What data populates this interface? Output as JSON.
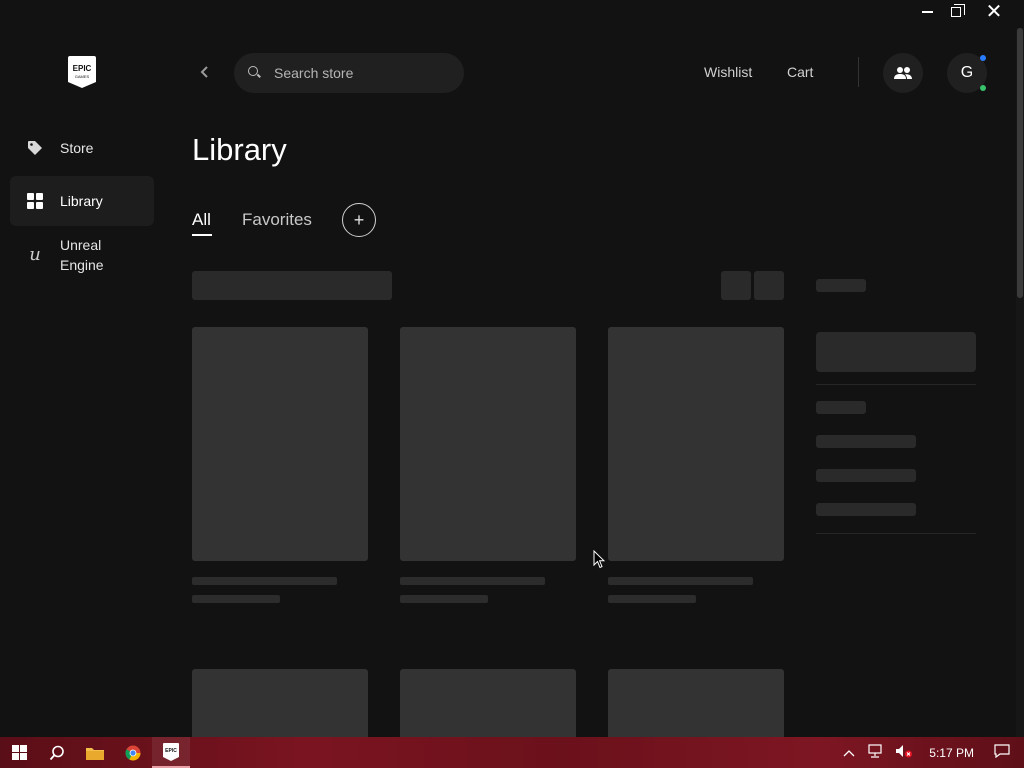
{
  "window": {
    "minimize": "minimize",
    "restore": "restore",
    "close": "close"
  },
  "sidebar": {
    "logo_text": "EPIC GAMES",
    "items": [
      {
        "label": "Store",
        "icon": "tag-icon"
      },
      {
        "label": "Library",
        "icon": "grid-icon",
        "active": true
      },
      {
        "label": "Unreal\nEngine",
        "icon": "unreal-icon"
      }
    ]
  },
  "header": {
    "search_placeholder": "Search store",
    "wishlist": "Wishlist",
    "cart": "Cart",
    "avatar_initial": "G"
  },
  "main": {
    "title": "Library",
    "tabs": [
      {
        "label": "All",
        "active": true
      },
      {
        "label": "Favorites"
      }
    ],
    "add_tab": "+"
  },
  "taskbar": {
    "time": "5:17 PM",
    "apps": [
      "start",
      "search",
      "file-explorer",
      "chrome",
      "epic-games-launcher"
    ]
  },
  "colors": {
    "background": "#121212",
    "skeleton": "#333333",
    "accent_blue": "#2a7cff",
    "online_green": "#37c26b",
    "taskbar": "#6b111b"
  }
}
